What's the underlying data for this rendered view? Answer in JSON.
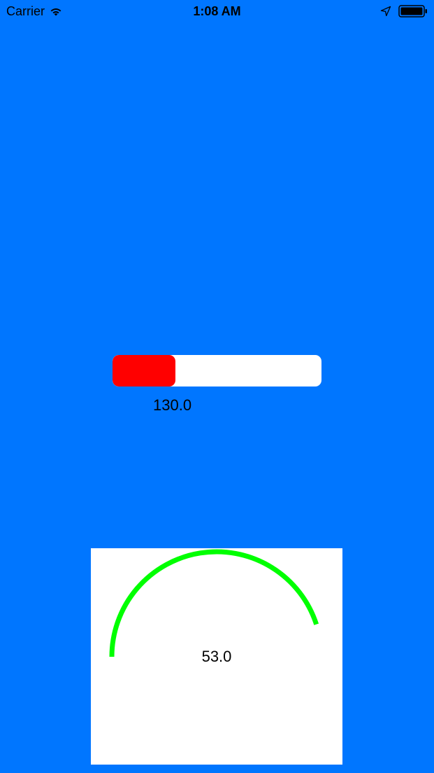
{
  "status_bar": {
    "carrier": "Carrier",
    "time": "1:08 AM",
    "icons": [
      "wifi-icon",
      "location-icon",
      "battery-icon"
    ]
  },
  "colors": {
    "background": "#0076FF",
    "progress_track": "#FFFFFF",
    "progress_fill": "#FF0000",
    "gauge_panel": "#FFFFFF",
    "gauge_arc": "#00FF00"
  },
  "progress": {
    "label": "130.0",
    "fill_fraction": 0.3
  },
  "gauge": {
    "label": "53.0",
    "sweep_fraction": 0.45
  }
}
